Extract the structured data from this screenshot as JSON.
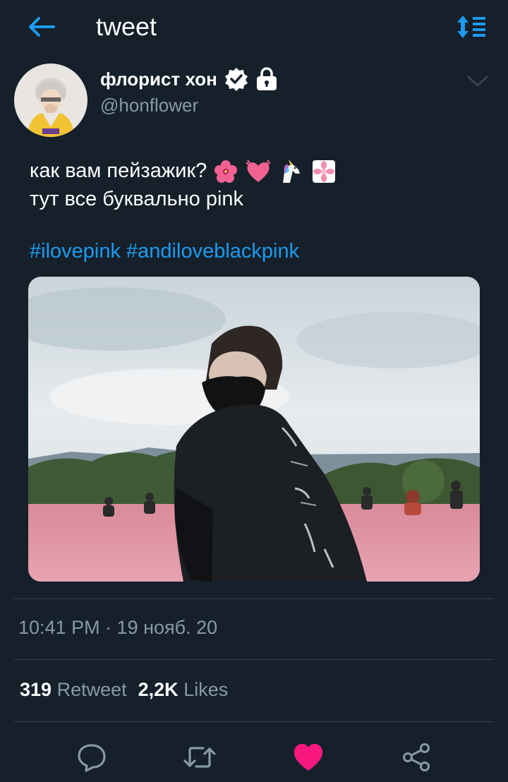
{
  "header": {
    "title": "tweet"
  },
  "author": {
    "display_name": "флорист хон",
    "handle": "@honflower"
  },
  "tweet": {
    "line1": "как вам пейзажик?",
    "line2": "тут все буквально pink",
    "hashtags": [
      "#ilovepink",
      "#andiloveblackpink"
    ],
    "emojis": [
      "hibiscus",
      "beating-heart",
      "unicorn",
      "white-flower"
    ]
  },
  "meta": {
    "timestamp": "10:41 PM · 19 нояб. 20"
  },
  "stats": {
    "retweets_count": "319",
    "retweets_label": "Retweet",
    "likes_count": "2,2K",
    "likes_label": "Likes"
  },
  "colors": {
    "background": "#15202b",
    "accent": "#1d9bf0",
    "like": "#f91880",
    "muted": "#8899a6",
    "divider": "#38444d"
  }
}
